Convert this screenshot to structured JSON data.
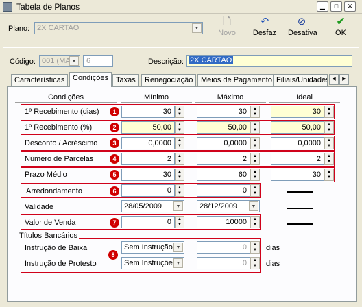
{
  "window": {
    "title": "Tabela de Planos",
    "controls": [
      "minimize",
      "maximize",
      "close"
    ]
  },
  "plano": {
    "label": "Plano:",
    "value": "2X CARTAO"
  },
  "toolbar": {
    "novo": "Novo",
    "desfaz": "Desfaz",
    "desativa": "Desativa",
    "ok": "OK"
  },
  "header": {
    "codigo_label": "Código:",
    "codigo_combo": "001 (MA",
    "codigo_num": "6",
    "descricao_label": "Descrição:",
    "descricao_value": "2X CARTAO"
  },
  "tabs": [
    "Características",
    "Condições",
    "Taxas",
    "Renegociação",
    "Meios de Pagamento",
    "Filiais/Unidades"
  ],
  "active_tab": "Condições",
  "columns": {
    "condicoes": "Condições",
    "minimo": "Mínimo",
    "maximo": "Máximo",
    "ideal": "Ideal"
  },
  "rows": [
    {
      "label": "1º Recebimento (dias)",
      "badge": "1",
      "min": "30",
      "max": "30",
      "ideal": "30"
    },
    {
      "label": "1º Recebimento (%)",
      "badge": "2",
      "min": "50,00",
      "max": "50,00",
      "ideal": "50,00"
    },
    {
      "label": "Desconto / Acréscimo",
      "badge": "3",
      "min": "0,0000",
      "max": "0,0000",
      "ideal": "0,0000"
    },
    {
      "label": "Número de Parcelas",
      "badge": "4",
      "min": "2",
      "max": "2",
      "ideal": "2"
    },
    {
      "label": "Prazo Médio",
      "badge": "5",
      "min": "30",
      "max": "60",
      "ideal": "30"
    },
    {
      "label": "Arredondamento",
      "badge": "6",
      "min": "0",
      "max": "0"
    },
    {
      "label": "Validade",
      "min": "28/05/2009",
      "max": "28/12/2009"
    },
    {
      "label": "Valor de Venda",
      "badge": "7",
      "min": "0",
      "max": "10000"
    }
  ],
  "titulos": {
    "group_label": "Títulos Bancários",
    "badge": "8",
    "baixa_label": "Instrução de Baixa",
    "baixa_combo": "Sem Instrução",
    "baixa_dias": "0",
    "protesto_label": "Instrução de Protesto",
    "protesto_combo": "Sem Instruções",
    "protesto_dias": "0",
    "dias_label": "dias"
  },
  "colors": {
    "highlight_border": "#d0021b",
    "badge": "#d00000",
    "yellow_field": "#ffffd4",
    "selection": "#316ac5"
  },
  "icons": [
    "app-icon",
    "new-document-icon",
    "undo-icon",
    "deactivate-icon",
    "checkmark-icon"
  ]
}
